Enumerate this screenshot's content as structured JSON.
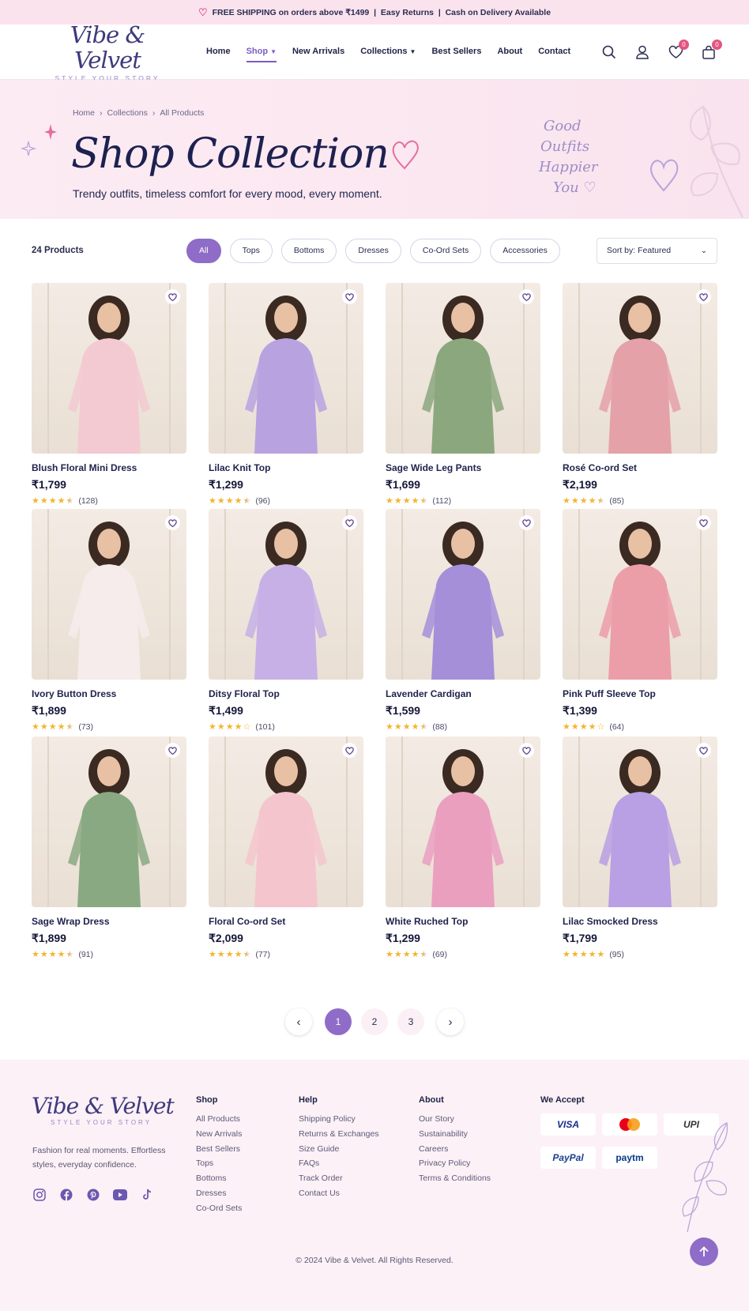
{
  "promo": {
    "text": "FREE SHIPPING on orders above ₹1499  |  Easy Returns  |  Cash on Delivery Available"
  },
  "brand": {
    "name": "Vibe & Velvet",
    "tagline": "STYLE YOUR STORY"
  },
  "nav": {
    "items": [
      "Home",
      "Shop",
      "New Arrivals",
      "Collections",
      "Best Sellers",
      "About",
      "Contact"
    ],
    "active": "Shop"
  },
  "header_icons": {
    "wishlist_count": "0",
    "cart_count": "0"
  },
  "hero": {
    "breadcrumb": [
      "Home",
      "Collections",
      "All Products"
    ],
    "title": "Shop Collection",
    "subtitle": "Trendy outfits, timeless comfort for every mood, every moment.",
    "quote": [
      "Good",
      "Outfits",
      "Happier",
      "You"
    ]
  },
  "filters": {
    "count": "24 Products",
    "chips": [
      "All",
      "Tops",
      "Bottoms",
      "Dresses",
      "Co-Ord Sets",
      "Accessories"
    ],
    "active": "All",
    "sort": "Sort by: Featured"
  },
  "products": [
    {
      "name": "Blush Floral Mini Dress",
      "price": "₹1,799",
      "rating": 4.5,
      "reviews": "(128)",
      "color": "#f3c9d2"
    },
    {
      "name": "Lilac Knit Top",
      "price": "₹1,299",
      "rating": 4.5,
      "reviews": "(96)",
      "color": "#b9a2e0"
    },
    {
      "name": "Sage Wide Leg Pants",
      "price": "₹1,699",
      "rating": 4.5,
      "reviews": "(112)",
      "color": "#8ba77e"
    },
    {
      "name": "Rosé Co-ord Set",
      "price": "₹2,199",
      "rating": 4.5,
      "reviews": "(85)",
      "color": "#e5a1a8"
    },
    {
      "name": "Ivory Button Dress",
      "price": "₹1,899",
      "rating": 4.5,
      "reviews": "(73)",
      "color": "#f6ecec"
    },
    {
      "name": "Ditsy Floral Top",
      "price": "₹1,499",
      "rating": 4,
      "reviews": "(101)",
      "color": "#c6b0e6"
    },
    {
      "name": "Lavender Cardigan",
      "price": "₹1,599",
      "rating": 4.5,
      "reviews": "(88)",
      "color": "#a58fd9"
    },
    {
      "name": "Pink Puff Sleeve Top",
      "price": "₹1,399",
      "rating": 4,
      "reviews": "(64)",
      "color": "#ec9ea8"
    },
    {
      "name": "Sage Wrap Dress",
      "price": "₹1,899",
      "rating": 4.5,
      "reviews": "(91)",
      "color": "#89a982"
    },
    {
      "name": "Floral Co-ord Set",
      "price": "₹2,099",
      "rating": 4.5,
      "reviews": "(77)",
      "color": "#f4c5cc"
    },
    {
      "name": "White Ruched Top",
      "price": "₹1,299",
      "rating": 4.5,
      "reviews": "(69)",
      "color": "#ea9fbf"
    },
    {
      "name": "Lilac Smocked Dress",
      "price": "₹1,799",
      "rating": 5,
      "reviews": "(95)",
      "color": "#b99fe4"
    }
  ],
  "pagination": {
    "pages": [
      "1",
      "2",
      "3"
    ],
    "current": "1",
    "prev": "‹",
    "next": "›"
  },
  "footer": {
    "description": "Fashion for real moments. Effortless styles, everyday confidence.",
    "columns": [
      {
        "title": "Shop",
        "links": [
          "All Products",
          "New Arrivals",
          "Best Sellers",
          "Tops",
          "Bottoms",
          "Dresses",
          "Co-Ord Sets"
        ]
      },
      {
        "title": "Help",
        "links": [
          "Shipping Policy",
          "Returns & Exchanges",
          "Size Guide",
          "FAQs",
          "Track Order",
          "Contact Us"
        ]
      },
      {
        "title": "About",
        "links": [
          "Our Story",
          "Sustainability",
          "Careers",
          "Privacy Policy",
          "Terms & Conditions"
        ]
      }
    ],
    "payments_title": "We Accept",
    "payments": [
      "VISA",
      "",
      "UPI",
      "PayPal",
      "paytm"
    ],
    "copyright": "© 2024 Vibe & Velvet. All Rights Reserved."
  },
  "colors": {
    "accent": "#8f6cc8",
    "hero_bg": "#fbe7f0",
    "promo_bg": "#fbe3ee",
    "star": "#f2b530"
  }
}
